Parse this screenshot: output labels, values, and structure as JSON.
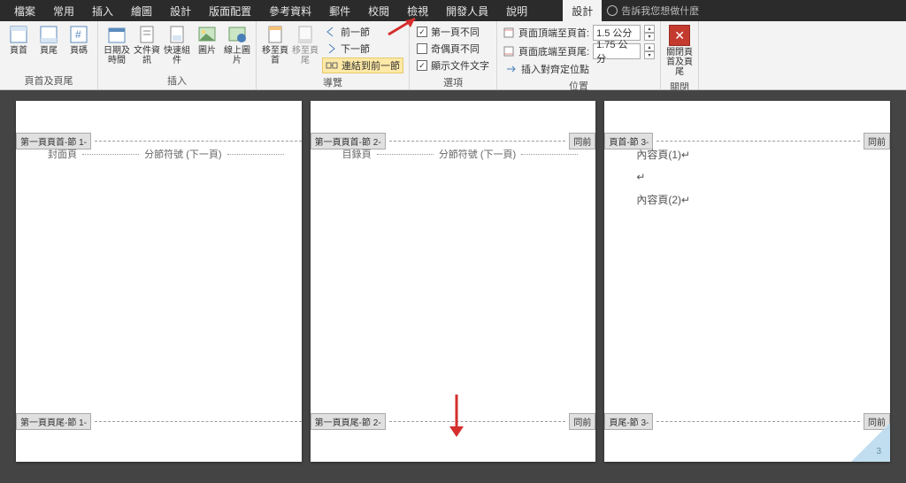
{
  "menu": {
    "tabs": [
      "檔案",
      "常用",
      "插入",
      "繪圖",
      "設計",
      "版面配置",
      "參考資料",
      "郵件",
      "校閱",
      "檢視",
      "開發人員",
      "說明"
    ],
    "designTab": "設計",
    "tellMe": "告訴我您想做什麼"
  },
  "ribbon": {
    "groupHeaderFooter": {
      "label": "頁首及頁尾",
      "header": "頁首",
      "footer": "頁尾",
      "pagenum": "頁碼"
    },
    "groupInsert": {
      "label": "插入",
      "datetime": "日期及時間",
      "docinfo": "文件資訊",
      "quickparts": "快速組件",
      "pictures": "圖片",
      "online": "線上圖片"
    },
    "groupNav": {
      "label": "導覽",
      "gohead": "移至頁首",
      "gofoot": "移至頁尾",
      "prev": "前一節",
      "next": "下一節",
      "link": "連結到前一節"
    },
    "groupOptions": {
      "label": "選項",
      "firstdiff": "第一頁不同",
      "oddeven": "奇偶頁不同",
      "showtext": "顯示文件文字"
    },
    "groupPos": {
      "label": "位置",
      "top": "頁面頂端至頁首:",
      "bot": "頁面底端至頁尾:",
      "topval": "1.5 公分",
      "botval": "1.75 公分",
      "aligntab": "插入對齊定位點"
    },
    "groupClose": {
      "label": "關閉",
      "close": "關閉頁首及頁尾"
    }
  },
  "pages": [
    {
      "headTag": "第一頁頁首-節 1-",
      "footTag": "第一頁頁尾-節 1-",
      "rightHead": "",
      "rightFoot": "",
      "body": {
        "title": "封面頁",
        "break": "分節符號 (下一頁)"
      }
    },
    {
      "headTag": "第一頁頁首-節 2-",
      "footTag": "第一頁頁尾-節 2-",
      "rightHead": "同前",
      "rightFoot": "同前",
      "body": {
        "title": "目錄頁",
        "break": "分節符號 (下一頁)"
      }
    },
    {
      "headTag": "頁首-節 3-",
      "footTag": "頁尾-節 3-",
      "rightHead": "同前",
      "rightFoot": "同前",
      "body": {
        "l1": "內容頁(1)↵",
        "l2": "↵",
        "l3": "內容頁(2)↵"
      }
    }
  ],
  "pageNumber": "3"
}
